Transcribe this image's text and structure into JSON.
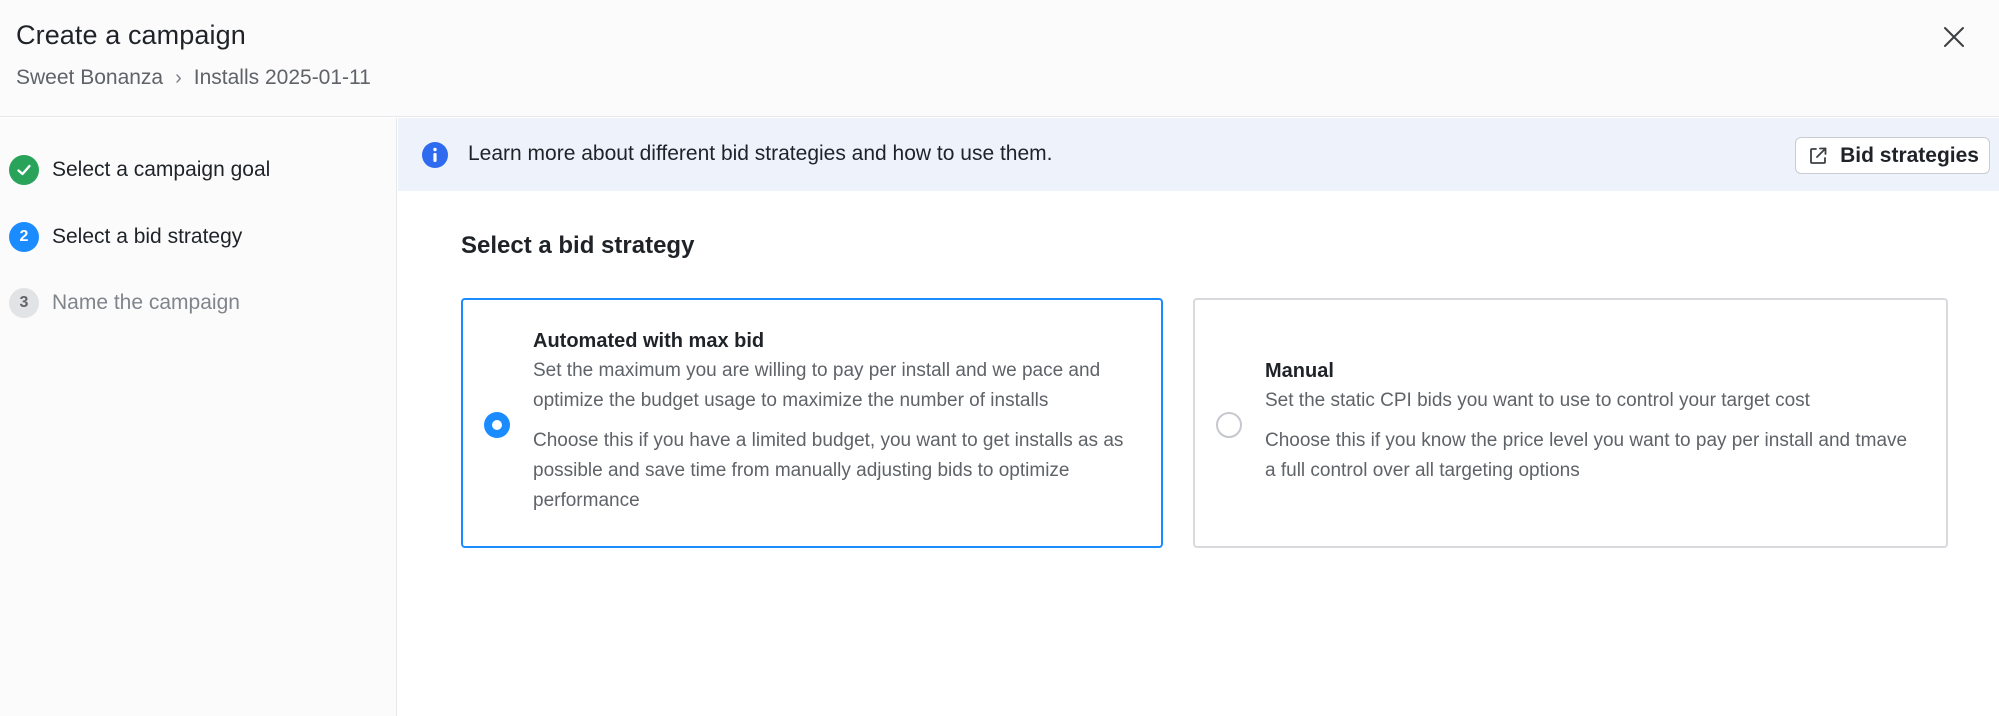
{
  "header": {
    "title": "Create a campaign",
    "breadcrumb": [
      "Sweet Bonanza",
      "Installs 2025-01-11"
    ],
    "breadcrumb_separator": "›",
    "close_icon": "close-icon"
  },
  "steps": [
    {
      "number": "1",
      "label": "Select a campaign goal",
      "status": "done",
      "icon": "check-icon"
    },
    {
      "number": "2",
      "label": "Select a bid strategy",
      "status": "active"
    },
    {
      "number": "3",
      "label": "Name the campaign",
      "status": "pending"
    }
  ],
  "banner": {
    "icon": "info-icon",
    "text": "Learn more about different bid strategies and how to use them.",
    "button_label": "Bid strategies",
    "button_icon": "external-link-icon"
  },
  "section_title": "Select a bid strategy",
  "options": [
    {
      "title": "Automated with max bid",
      "description": "Set the maximum you are willing to pay per install and we pace and optimize the budget usage to maximize the number of installs",
      "hint": "Choose this if you have a limited budget, you want to get installs as as possible and save time from manually adjusting bids to optimize performance",
      "selected": true
    },
    {
      "title": "Manual",
      "description": "Set the static CPI bids you want to use to control your target cost",
      "hint": "Choose this if you know the price level you want to pay per install and tmave a full control over all targeting options",
      "selected": false
    }
  ],
  "colors": {
    "accent": "#1a8cff",
    "success": "#29a35a",
    "banner_bg": "#eef2fb",
    "info_icon": "#2f6bf0"
  }
}
